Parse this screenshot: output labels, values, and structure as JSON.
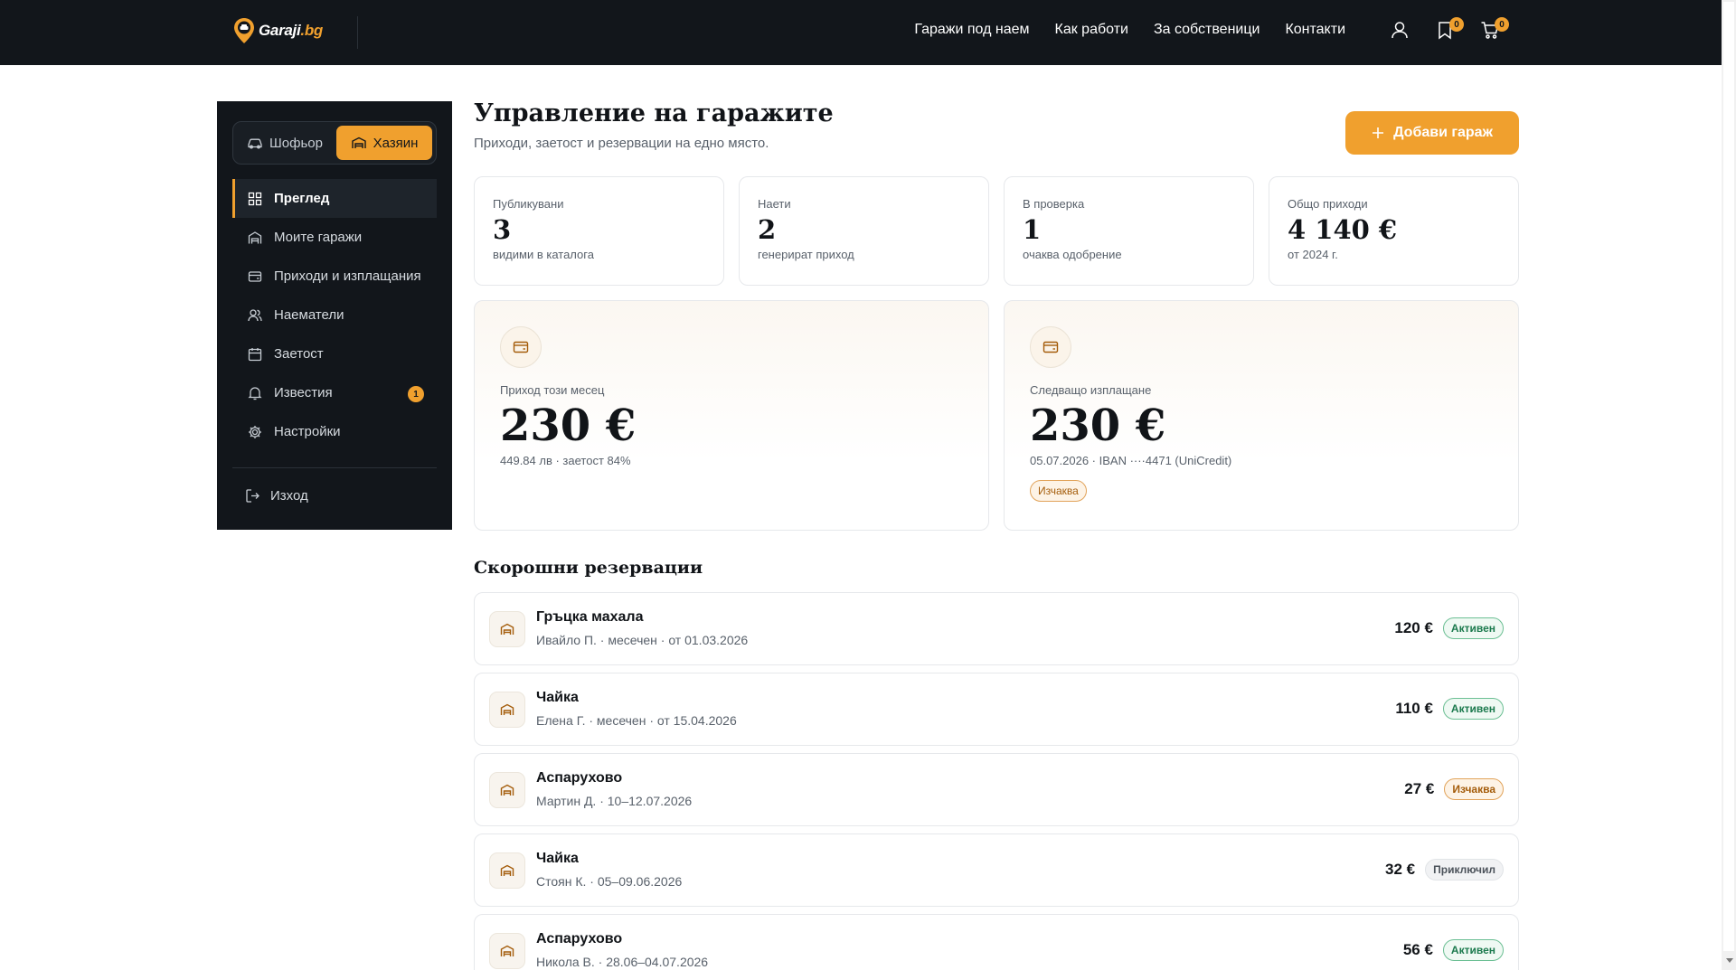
{
  "brand": {
    "name_main": "Garaji",
    "name_suffix": ".bg"
  },
  "nav": {
    "links": [
      "Гаражи под наем",
      "Как работи",
      "За собственици",
      "Контакти"
    ],
    "wishlist_count": "0",
    "cart_count": "0"
  },
  "sidebar": {
    "roles": [
      {
        "label": "Шофьор",
        "icon": "car-icon",
        "active": false
      },
      {
        "label": "Хазяин",
        "icon": "garage-icon",
        "active": true
      }
    ],
    "items": [
      {
        "label": "Преглед",
        "icon": "grid-icon",
        "active": true
      },
      {
        "label": "Моите гаражи",
        "icon": "garage-icon"
      },
      {
        "label": "Приходи и изплащания",
        "icon": "wallet-icon"
      },
      {
        "label": "Наематели",
        "icon": "users-icon"
      },
      {
        "label": "Заетост",
        "icon": "calendar-icon"
      },
      {
        "label": "Известия",
        "icon": "bell-icon",
        "badge": "1"
      },
      {
        "label": "Настройки",
        "icon": "gear-icon"
      }
    ],
    "logout": "Изход"
  },
  "header": {
    "title": "Управление на гаражите",
    "subtitle": "Приходи, заетост и резервации на едно място.",
    "add_button": "Добави гараж"
  },
  "stats": [
    {
      "label": "Публикувани",
      "value": "3",
      "note": "видими в каталога"
    },
    {
      "label": "Наети",
      "value": "2",
      "note": "генерират приход"
    },
    {
      "label": "В проверка",
      "value": "1",
      "note": "очаква одобрение"
    },
    {
      "label": "Общо приходи",
      "value": "4 140 €",
      "note": "от 2024 г."
    }
  ],
  "income": {
    "label": "Приход този месец",
    "value": "230 €",
    "note": "449.84 лв · заетост 84%"
  },
  "payout": {
    "label": "Следващо изплащане",
    "value": "230 €",
    "note": "05.07.2026 · IBAN ····4471 (UniCredit)",
    "status": "Изчаква"
  },
  "recent": {
    "title": "Скорошни резервации",
    "rows": [
      {
        "title": "Гръцка махала",
        "sub": "Ивайло П. · месечен · от 01.03.2026",
        "price": "120 €",
        "status": "Активен",
        "kind": "active"
      },
      {
        "title": "Чайка",
        "sub": "Елена Г. · месечен · от 15.04.2026",
        "price": "110 €",
        "status": "Активен",
        "kind": "active"
      },
      {
        "title": "Аспарухово",
        "sub": "Мартин Д. · 10–12.07.2026",
        "price": "27 €",
        "status": "Изчаква",
        "kind": "pending"
      },
      {
        "title": "Чайка",
        "sub": "Стоян К. · 05–09.06.2026",
        "price": "32 €",
        "status": "Приключил",
        "kind": "done"
      },
      {
        "title": "Аспарухово",
        "sub": "Никола В. · 28.06–04.07.2026",
        "price": "56 €",
        "status": "Активен",
        "kind": "active"
      }
    ]
  },
  "colors": {
    "accent": "#f0a02e",
    "dark": "#12161b",
    "success": "#1c7a4e"
  }
}
